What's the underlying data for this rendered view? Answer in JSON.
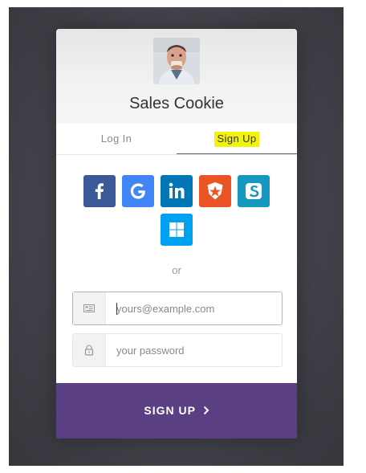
{
  "app": {
    "title": "Sales Cookie"
  },
  "tabs": [
    {
      "label": "Log In"
    },
    {
      "label": "Sign Up"
    }
  ],
  "social": [
    {
      "name": "facebook",
      "color": "#3b5998",
      "icon": "facebook-icon"
    },
    {
      "name": "google",
      "color": "#4285f4",
      "icon": "google-icon"
    },
    {
      "name": "linkedin",
      "color": "#0077b5",
      "icon": "linkedin-icon"
    },
    {
      "name": "auth0",
      "color": "#eb5424",
      "icon": "auth0-icon"
    },
    {
      "name": "salesforce",
      "color": "#1798c1",
      "icon": "salesforce-icon"
    },
    {
      "name": "microsoft",
      "color": "#00a1f1",
      "icon": "windows-icon"
    }
  ],
  "separator": "or",
  "form": {
    "email_placeholder": "yours@example.com",
    "password_placeholder": "your password"
  },
  "submit": {
    "label": "SIGN UP"
  },
  "colors": {
    "submit": "#5a3f82",
    "highlight": "#f2f20a"
  }
}
